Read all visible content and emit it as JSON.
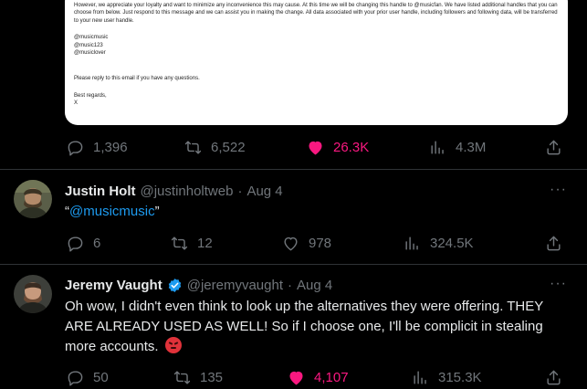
{
  "email": {
    "paragraph1": "However, we appreciate your loyalty and want to minimize any inconvenience this may cause.  At this time we will be changing this handle to @musicfan. We have listed additional handles that you can choose from below. Just respond to this message and we can assist you in making the change. All data associated with your prior user handle, including followers and following data, will be transferred to your new user handle.",
    "handles": [
      "@musicmusic",
      "@music123",
      "@musiclover"
    ],
    "reply_note": "Please reply to this email if you have any questions.",
    "signoff": "Best regards,",
    "signature": "X"
  },
  "main_tweet_actions": {
    "replies": "1,396",
    "retweets": "6,522",
    "likes": "26.3K",
    "views": "4.3M"
  },
  "replies": [
    {
      "name": "Justin Holt",
      "handle": "@justinholtweb",
      "separator": "·",
      "date": "Aug 4",
      "quote_open": "“",
      "mention": "@musicmusic",
      "quote_close": "”",
      "more": "···",
      "actions": {
        "replies": "6",
        "retweets": "12",
        "likes": "978",
        "views": "324.5K"
      }
    },
    {
      "name": "Jeremy Vaught",
      "handle": "@jeremyvaught",
      "separator": "·",
      "date": "Aug 4",
      "verified": true,
      "text": "Oh wow, I didn't even think to look up the alternatives they were offering. THEY ARE ALREADY USED AS WELL! So if I choose one, I'll be complicit in stealing more accounts.",
      "more": "···",
      "actions": {
        "replies": "50",
        "retweets": "135",
        "likes": "4,107",
        "views": "315.3K"
      }
    }
  ],
  "colors": {
    "background": "#000000",
    "text": "#e7e9ea",
    "muted": "#71767b",
    "like": "#f91880",
    "link": "#1d9bf0",
    "divider": "#2f3336"
  }
}
